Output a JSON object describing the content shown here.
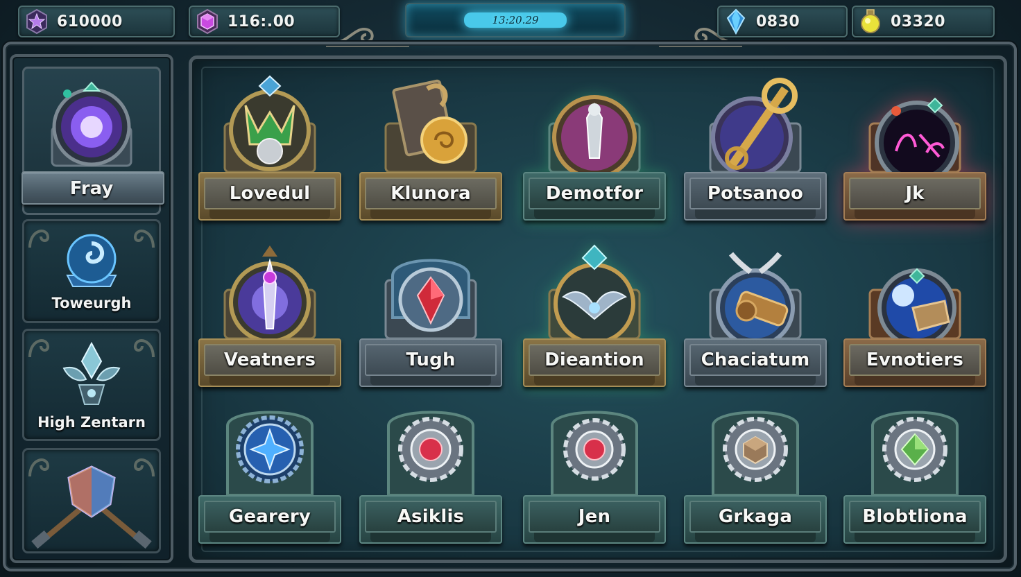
{
  "currencies": [
    {
      "id": "star-gem",
      "value": "610000",
      "icon": "purple-star-gem-icon",
      "color": "#a05bd6"
    },
    {
      "id": "hex-gem",
      "value": "116:.00",
      "icon": "purple-hex-gem-icon",
      "color": "#c241d6"
    },
    {
      "id": "crystal",
      "value": "0830",
      "icon": "blue-crystal-icon",
      "color": "#3aa8e6"
    },
    {
      "id": "potion",
      "value": "03320",
      "icon": "yellow-potion-icon",
      "color": "#e6d626"
    }
  ],
  "timer": {
    "text": "13:20.29"
  },
  "sidebar": {
    "items": [
      {
        "label": "Fray",
        "icon": "purple-orb-icon"
      },
      {
        "label": "Toweurgh",
        "icon": "blue-swirl-emblem-icon"
      },
      {
        "label": "High Zentarn",
        "icon": "winged-crest-icon"
      },
      {
        "label": "",
        "icon": "crossed-hammers-shield-icon"
      }
    ]
  },
  "grid": {
    "rows": [
      [
        {
          "label": "Lovedul",
          "icon": "green-gold-helm-emblem-icon"
        },
        {
          "label": "Klunora",
          "icon": "spellbook-coin-icon"
        },
        {
          "label": "Demotfor",
          "icon": "silver-statue-medallion-icon"
        },
        {
          "label": "Potsanoo",
          "icon": "golden-key-sword-icon"
        },
        {
          "label": "Jk",
          "icon": "neon-rune-orb-icon"
        }
      ],
      [
        {
          "label": "Veatners",
          "icon": "amethyst-dagger-emblem-icon"
        },
        {
          "label": "Tugh",
          "icon": "ruby-shield-icon"
        },
        {
          "label": "Dieantion",
          "icon": "winged-crown-crest-icon"
        },
        {
          "label": "Chaciatum",
          "icon": "bronze-cannon-icon"
        },
        {
          "label": "Evnotiers",
          "icon": "crystal-ball-pedestal-icon"
        }
      ],
      [
        {
          "label": "Gearery",
          "icon": "sapphire-star-gear-icon"
        },
        {
          "label": "Asiklis",
          "icon": "ruby-gear-icon"
        },
        {
          "label": "Jen",
          "icon": "ruby-gear-small-icon"
        },
        {
          "label": "Grkaga",
          "icon": "bronze-cube-gear-icon"
        },
        {
          "label": "Blobtliona",
          "icon": "emerald-gear-icon"
        }
      ]
    ]
  }
}
